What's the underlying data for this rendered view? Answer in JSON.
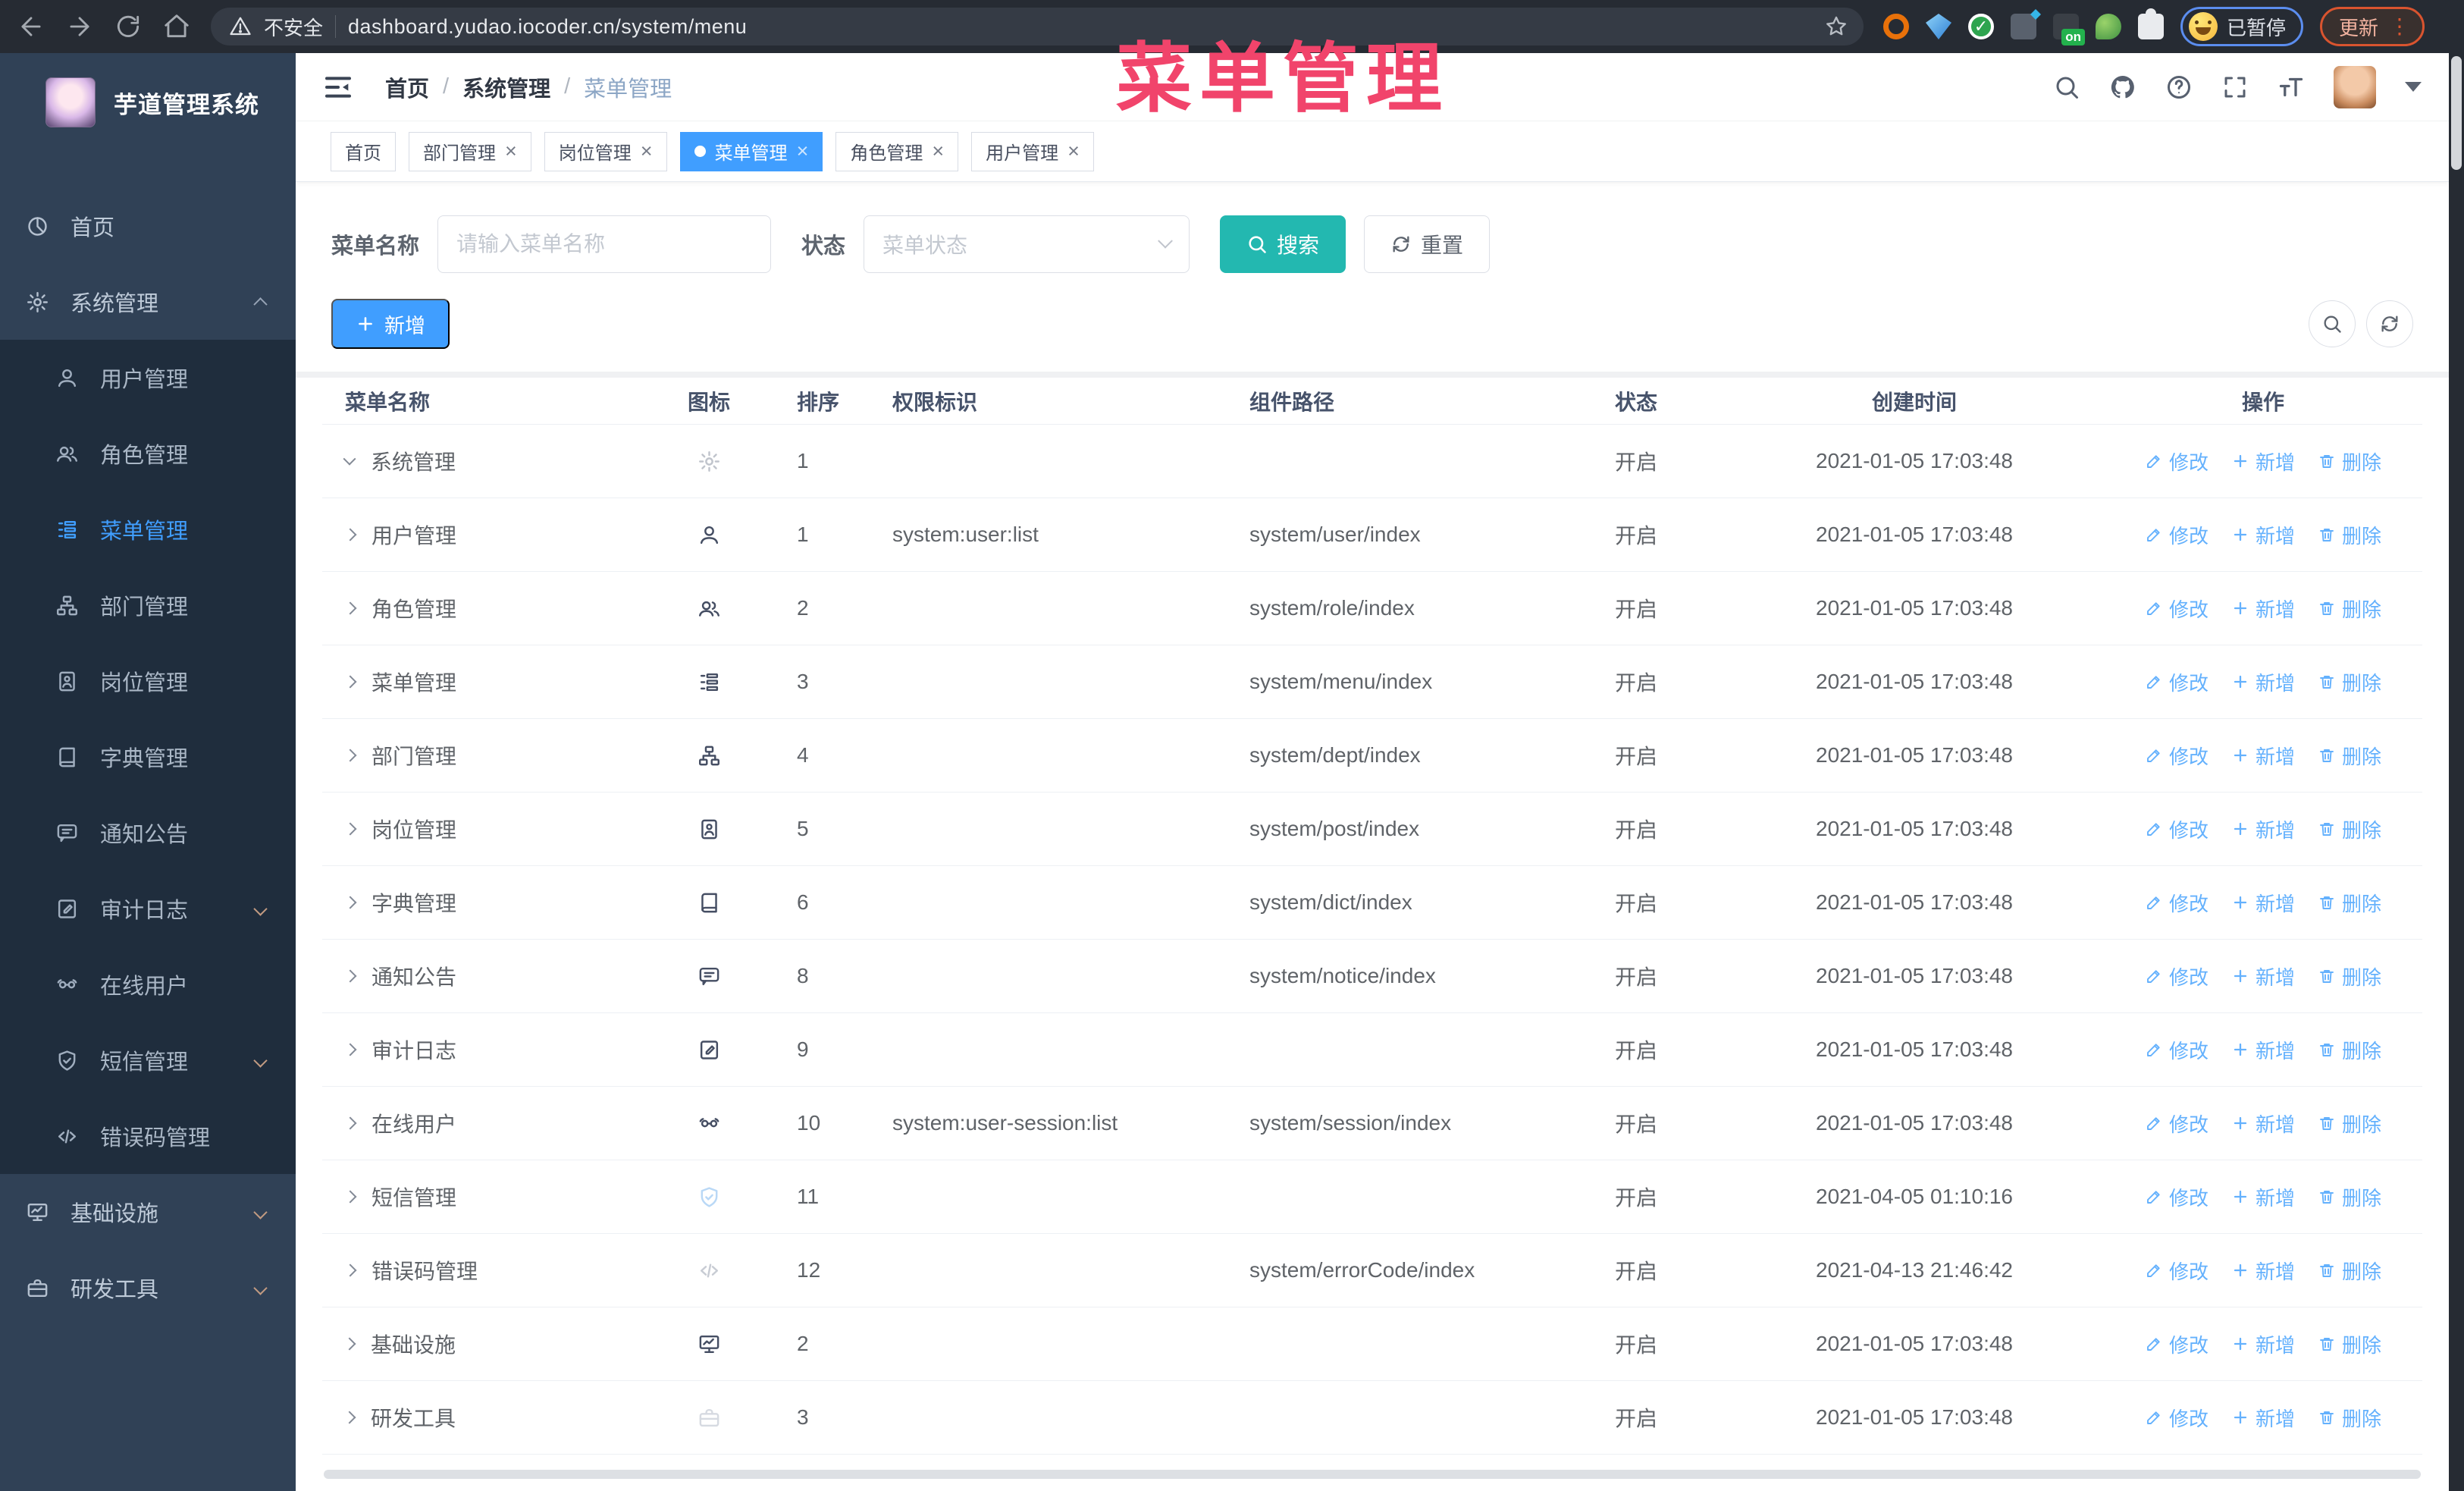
{
  "watermark": {
    "text": "菜单管理",
    "color": "#f1446b"
  },
  "browser": {
    "security_label": "不安全",
    "url": "dashboard.yudao.iocoder.cn/system/menu",
    "on_badge": "on",
    "paused_label": "已暂停",
    "update_label": "更新",
    "update_dots": "⋮"
  },
  "sidebar": {
    "title": "芋道管理系统",
    "items": [
      {
        "key": "home",
        "label": "首页",
        "icon": "dashboard-icon",
        "type": "root"
      },
      {
        "key": "system",
        "label": "系统管理",
        "icon": "gear-icon",
        "type": "root",
        "caret": "up"
      },
      {
        "key": "user",
        "label": "用户管理",
        "icon": "user-icon",
        "type": "sub"
      },
      {
        "key": "role",
        "label": "角色管理",
        "icon": "users-icon",
        "type": "sub"
      },
      {
        "key": "menu",
        "label": "菜单管理",
        "icon": "menu-tree-icon",
        "type": "sub",
        "active": true
      },
      {
        "key": "dept",
        "label": "部门管理",
        "icon": "org-icon",
        "type": "sub"
      },
      {
        "key": "post",
        "label": "岗位管理",
        "icon": "badge-icon",
        "type": "sub"
      },
      {
        "key": "dict",
        "label": "字典管理",
        "icon": "dict-icon",
        "type": "sub"
      },
      {
        "key": "notice",
        "label": "通知公告",
        "icon": "notice-icon",
        "type": "sub"
      },
      {
        "key": "audit",
        "label": "审计日志",
        "icon": "log-icon",
        "type": "sub",
        "caret": "down"
      },
      {
        "key": "online",
        "label": "在线用户",
        "icon": "goggles-icon",
        "type": "sub"
      },
      {
        "key": "sms",
        "label": "短信管理",
        "icon": "shield-icon",
        "type": "sub",
        "caret": "down"
      },
      {
        "key": "errcode",
        "label": "错误码管理",
        "icon": "code-icon",
        "type": "sub"
      },
      {
        "key": "infra",
        "label": "基础设施",
        "icon": "monitor-icon",
        "type": "root",
        "caret": "down"
      },
      {
        "key": "tools",
        "label": "研发工具",
        "icon": "toolbox-icon",
        "type": "root",
        "caret": "down"
      }
    ]
  },
  "header": {
    "breadcrumb": [
      "首页",
      "系统管理",
      "菜单管理"
    ]
  },
  "tabs": [
    {
      "key": "home",
      "label": "首页",
      "closable": false,
      "active": false
    },
    {
      "key": "dept",
      "label": "部门管理",
      "closable": true,
      "active": false
    },
    {
      "key": "post",
      "label": "岗位管理",
      "closable": true,
      "active": false
    },
    {
      "key": "menu",
      "label": "菜单管理",
      "closable": true,
      "active": true
    },
    {
      "key": "role",
      "label": "角色管理",
      "closable": true,
      "active": false
    },
    {
      "key": "user",
      "label": "用户管理",
      "closable": true,
      "active": false
    }
  ],
  "filters": {
    "name_label": "菜单名称",
    "name_placeholder": "请输入菜单名称",
    "status_label": "状态",
    "status_placeholder": "菜单状态",
    "search_label": "搜索",
    "reset_label": "重置"
  },
  "toolbar": {
    "add_label": "新增"
  },
  "table": {
    "columns": [
      "菜单名称",
      "图标",
      "排序",
      "权限标识",
      "组件路径",
      "状态",
      "创建时间",
      "操作"
    ],
    "action_labels": {
      "edit": "修改",
      "add": "新增",
      "delete": "删除"
    },
    "rows": [
      {
        "key": "system",
        "name": "系统管理",
        "icon": "gear-icon",
        "icon_color": "#c0c4cc",
        "level": 0,
        "expanded": true,
        "sort": "1",
        "perm": "",
        "path": "",
        "status": "开启",
        "time": "2021-01-05 17:03:48"
      },
      {
        "key": "user",
        "name": "用户管理",
        "icon": "user-icon",
        "level": 1,
        "sort": "1",
        "perm": "system:user:list",
        "path": "system/user/index",
        "status": "开启",
        "time": "2021-01-05 17:03:48"
      },
      {
        "key": "role",
        "name": "角色管理",
        "icon": "users-icon",
        "level": 1,
        "sort": "2",
        "perm": "",
        "path": "system/role/index",
        "status": "开启",
        "time": "2021-01-05 17:03:48"
      },
      {
        "key": "menu",
        "name": "菜单管理",
        "icon": "menu-tree-icon",
        "level": 1,
        "sort": "3",
        "perm": "",
        "path": "system/menu/index",
        "status": "开启",
        "time": "2021-01-05 17:03:48"
      },
      {
        "key": "dept",
        "name": "部门管理",
        "icon": "org-icon",
        "level": 1,
        "sort": "4",
        "perm": "",
        "path": "system/dept/index",
        "status": "开启",
        "time": "2021-01-05 17:03:48"
      },
      {
        "key": "post",
        "name": "岗位管理",
        "icon": "badge-icon",
        "level": 1,
        "sort": "5",
        "perm": "",
        "path": "system/post/index",
        "status": "开启",
        "time": "2021-01-05 17:03:48"
      },
      {
        "key": "dict",
        "name": "字典管理",
        "icon": "dict-icon",
        "level": 1,
        "sort": "6",
        "perm": "",
        "path": "system/dict/index",
        "status": "开启",
        "time": "2021-01-05 17:03:48"
      },
      {
        "key": "notice",
        "name": "通知公告",
        "icon": "notice-icon",
        "level": 1,
        "sort": "8",
        "perm": "",
        "path": "system/notice/index",
        "status": "开启",
        "time": "2021-01-05 17:03:48"
      },
      {
        "key": "audit",
        "name": "审计日志",
        "icon": "log-icon",
        "level": 1,
        "sort": "9",
        "perm": "",
        "path": "",
        "status": "开启",
        "time": "2021-01-05 17:03:48"
      },
      {
        "key": "online",
        "name": "在线用户",
        "icon": "goggles-icon",
        "level": 1,
        "sort": "10",
        "perm": "system:user-session:list",
        "path": "system/session/index",
        "status": "开启",
        "time": "2021-01-05 17:03:48"
      },
      {
        "key": "sms",
        "name": "短信管理",
        "icon": "shield-icon",
        "icon_color": "#b9d8f6",
        "level": 1,
        "sort": "11",
        "perm": "",
        "path": "",
        "status": "开启",
        "time": "2021-04-05 01:10:16"
      },
      {
        "key": "errcode",
        "name": "错误码管理",
        "icon": "code-icon",
        "icon_color": "#c8ccd4",
        "level": 1,
        "sort": "12",
        "perm": "",
        "path": "system/errorCode/index",
        "status": "开启",
        "time": "2021-04-13 21:46:42"
      },
      {
        "key": "infra",
        "name": "基础设施",
        "icon": "monitor-icon",
        "level": 0,
        "sort": "2",
        "perm": "",
        "path": "",
        "status": "开启",
        "time": "2021-01-05 17:03:48"
      },
      {
        "key": "tools",
        "name": "研发工具",
        "icon": "toolbox-icon",
        "icon_color": "#d6dae1",
        "level": 0,
        "sort": "3",
        "perm": "",
        "path": "",
        "status": "开启",
        "time": "2021-01-05 17:03:48"
      }
    ]
  },
  "colors": {
    "accent": "#409eff",
    "search_button": "#23b8b0",
    "action_link": "#64b1fd",
    "sidebar_bg": "#304156",
    "submenu_bg": "#1f2d3d",
    "row_icon_default": "#454e63"
  }
}
